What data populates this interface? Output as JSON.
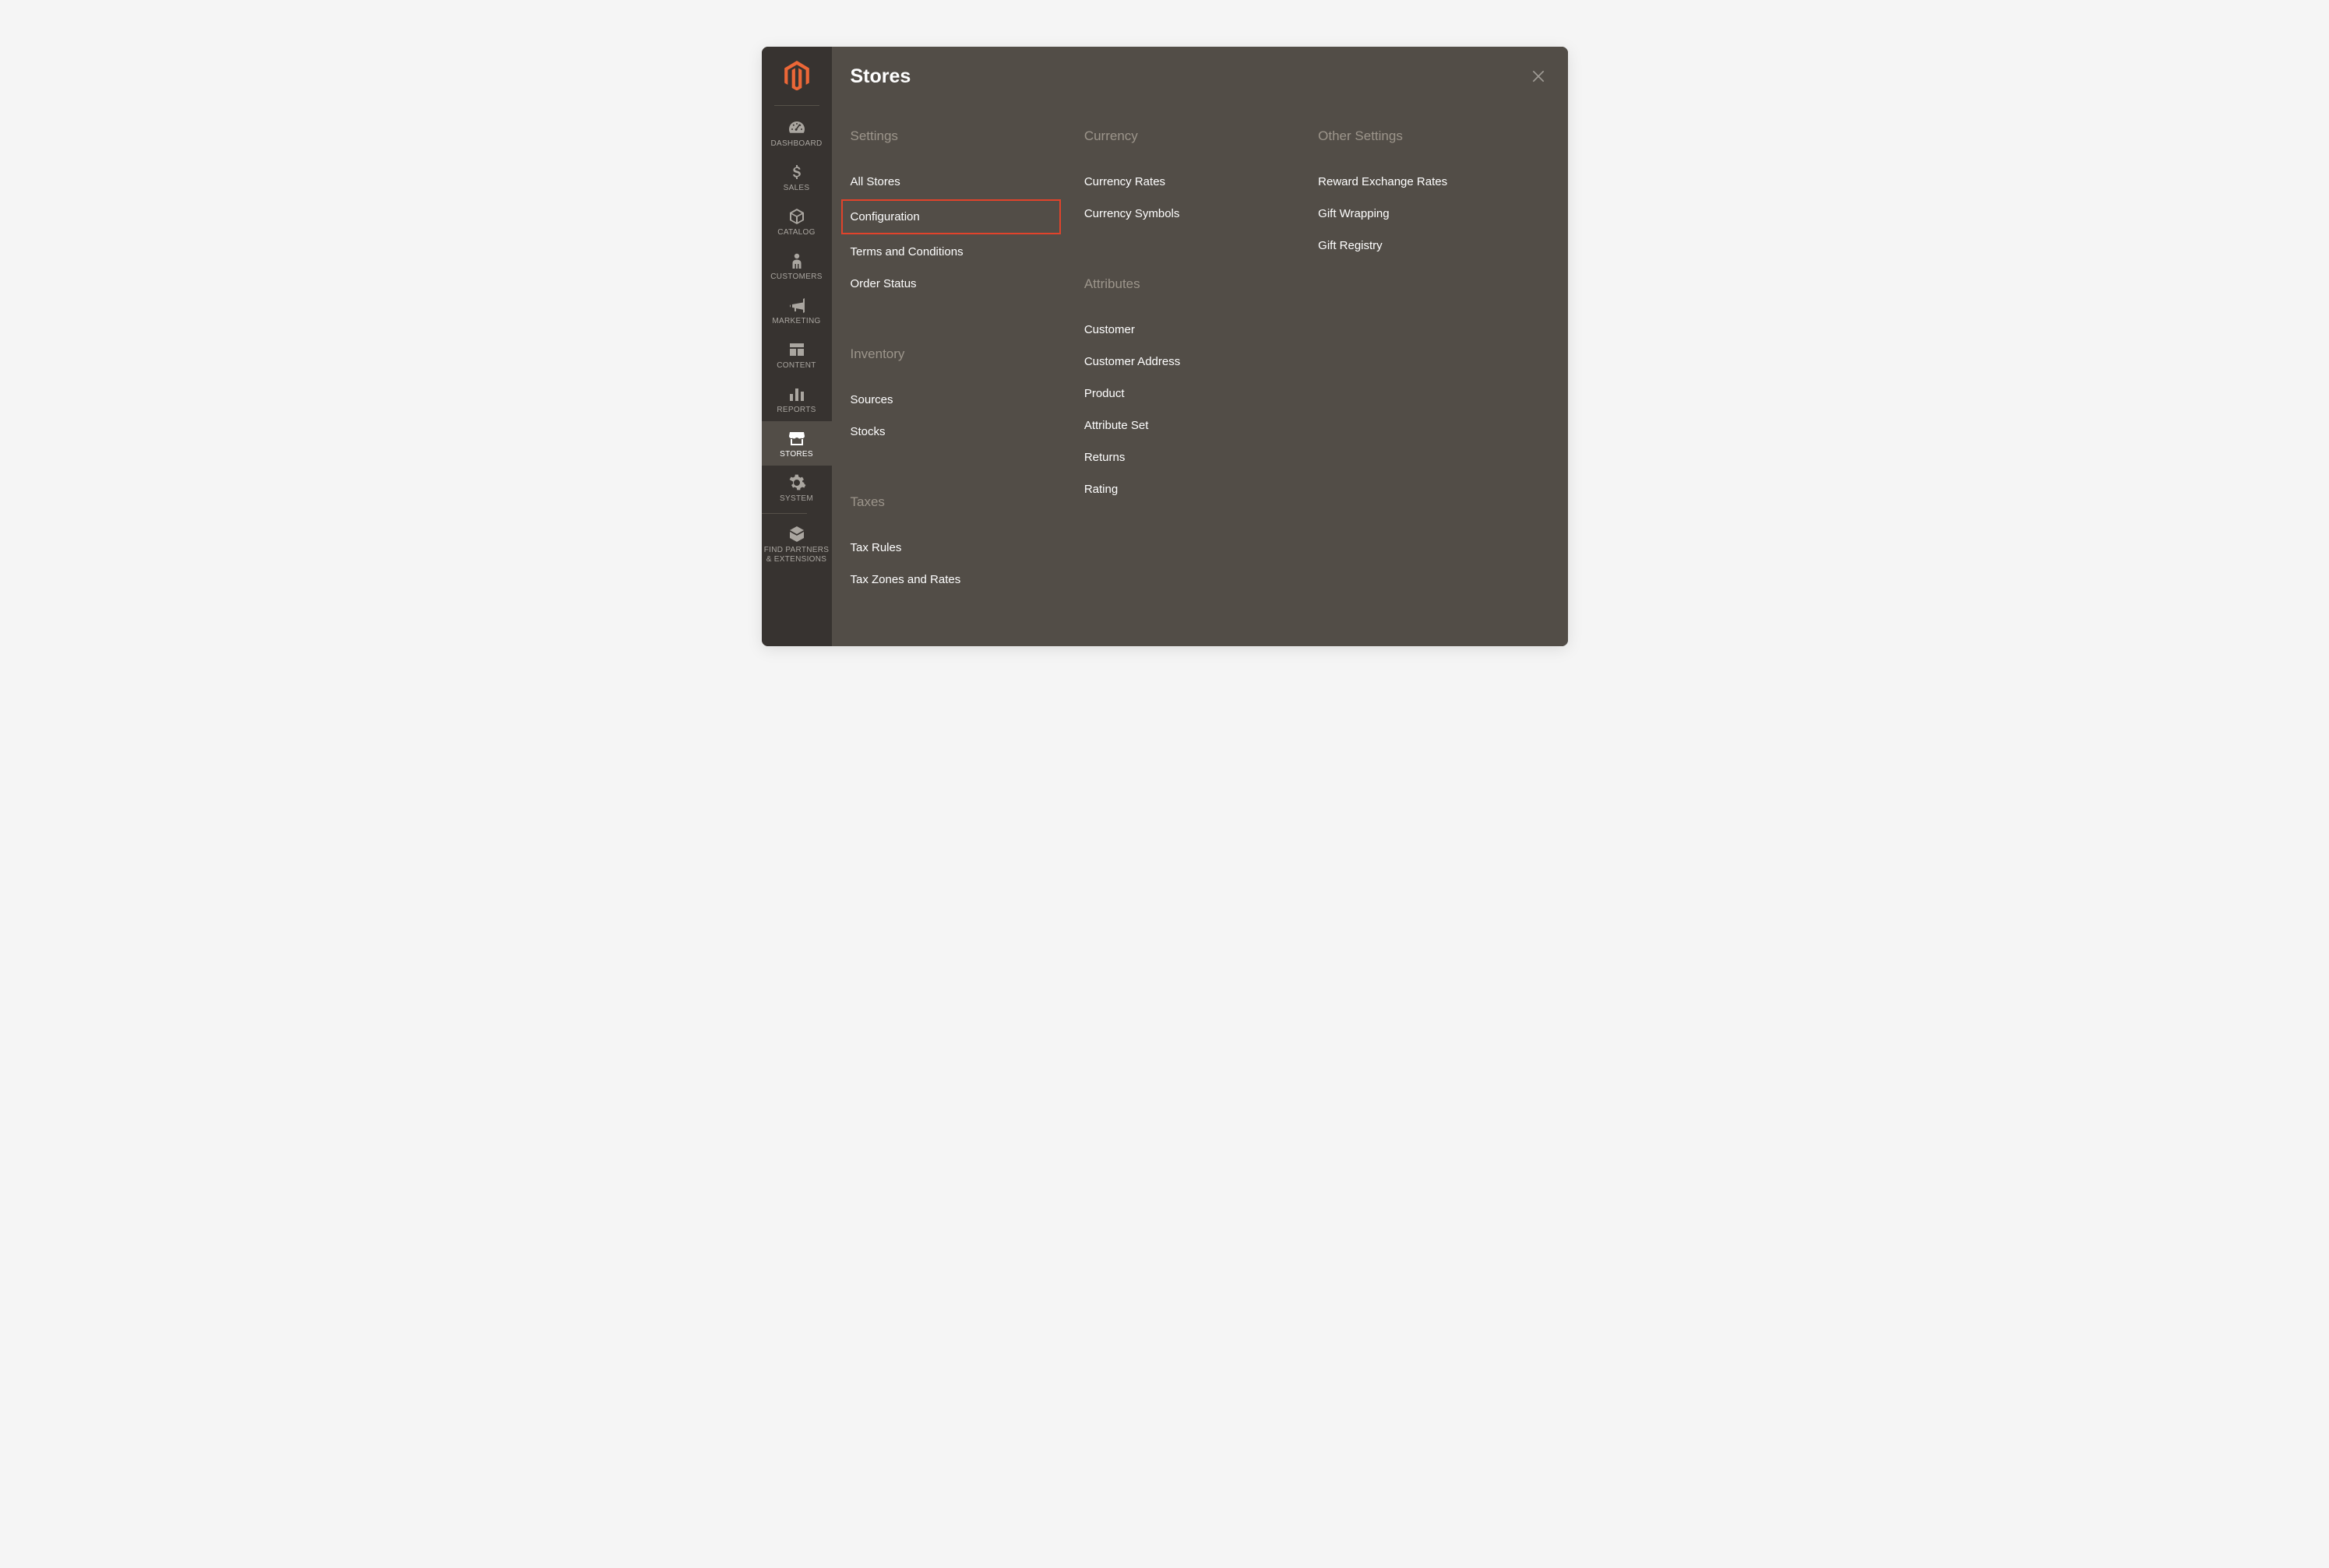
{
  "panel_title": "Stores",
  "sidebar": [
    {
      "id": "dashboard",
      "label": "DASHBOARD",
      "icon": "gauge"
    },
    {
      "id": "sales",
      "label": "SALES",
      "icon": "dollar"
    },
    {
      "id": "catalog",
      "label": "CATALOG",
      "icon": "box"
    },
    {
      "id": "customers",
      "label": "CUSTOMERS",
      "icon": "person"
    },
    {
      "id": "marketing",
      "label": "MARKETING",
      "icon": "megaphone"
    },
    {
      "id": "content",
      "label": "CONTENT",
      "icon": "layout"
    },
    {
      "id": "reports",
      "label": "REPORTS",
      "icon": "bars"
    },
    {
      "id": "stores",
      "label": "STORES",
      "icon": "storefront",
      "active": true
    },
    {
      "id": "system",
      "label": "SYSTEM",
      "icon": "gear"
    },
    {
      "id": "partners",
      "label": "FIND PARTNERS & EXTENSIONS",
      "icon": "cube",
      "divider_before": true
    }
  ],
  "columns": [
    {
      "groups": [
        {
          "heading": "Settings",
          "items": [
            {
              "label": "All Stores"
            },
            {
              "label": "Configuration",
              "highlighted": true
            },
            {
              "label": "Terms and Conditions"
            },
            {
              "label": "Order Status"
            }
          ]
        },
        {
          "heading": "Inventory",
          "items": [
            {
              "label": "Sources"
            },
            {
              "label": "Stocks"
            }
          ]
        },
        {
          "heading": "Taxes",
          "items": [
            {
              "label": "Tax Rules"
            },
            {
              "label": "Tax Zones and Rates"
            }
          ]
        }
      ]
    },
    {
      "groups": [
        {
          "heading": "Currency",
          "items": [
            {
              "label": "Currency Rates"
            },
            {
              "label": "Currency Symbols"
            }
          ]
        },
        {
          "heading": "Attributes",
          "items": [
            {
              "label": "Customer"
            },
            {
              "label": "Customer Address"
            },
            {
              "label": "Product"
            },
            {
              "label": "Attribute Set"
            },
            {
              "label": "Returns"
            },
            {
              "label": "Rating"
            }
          ]
        }
      ]
    },
    {
      "groups": [
        {
          "heading": "Other Settings",
          "items": [
            {
              "label": "Reward Exchange Rates"
            },
            {
              "label": "Gift Wrapping"
            },
            {
              "label": "Gift Registry"
            }
          ]
        }
      ]
    }
  ]
}
